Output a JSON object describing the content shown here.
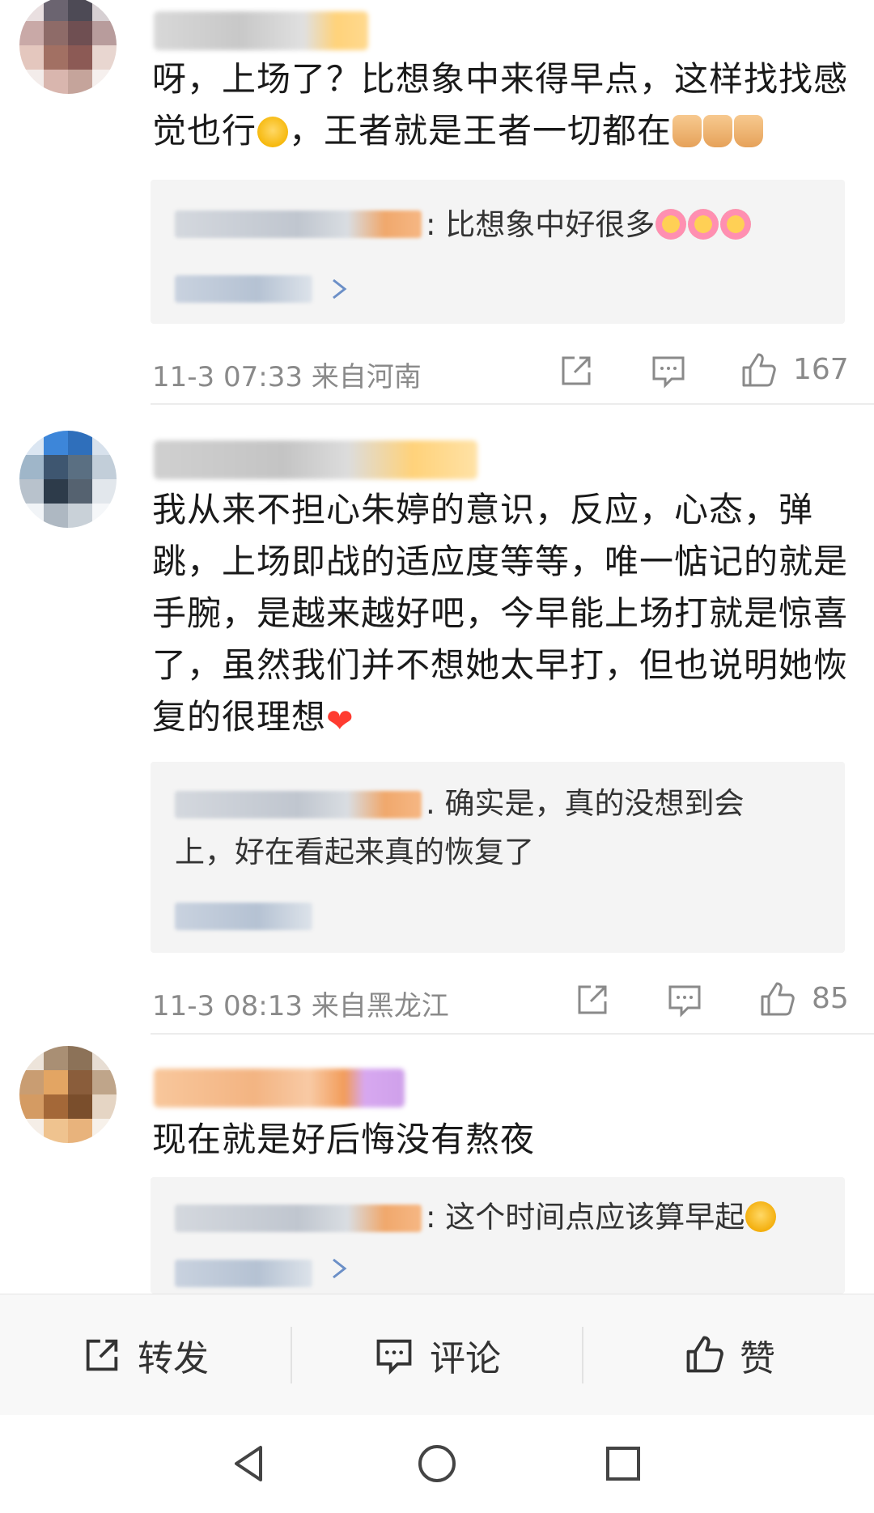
{
  "comments": [
    {
      "text_html_parts": [
        "呀，上场了？比想象中来得早点，这样找找感觉也行",
        "，王者就是王者一切都在"
      ],
      "reply": {
        "text": ": 比想象中好很多"
      },
      "time": "11-3 07:33",
      "location": "来自河南",
      "likes": "167"
    },
    {
      "text": "我从来不担心朱婷的意识，反应，心态，弹跳，上场即战的适应度等等，唯一惦记的就是手腕，是越来越好吧，今早能上场打就是惊喜了，虽然我们并不想她太早打，但也说明她恢复的很理想",
      "reply": {
        "line1": ". 确实是，真的没想到会",
        "line2": "上，好在看起来真的恢复了"
      },
      "time": "11-3 08:13",
      "location": "来自黑龙江",
      "likes": "85"
    },
    {
      "text": "现在就是好后悔没有熬夜",
      "reply": {
        "text": ": 这个时间点应该算早起"
      }
    }
  ],
  "bottom_bar": {
    "repost": "转发",
    "comment": "评论",
    "like": "赞"
  },
  "icons": {
    "share": "share-icon",
    "comment": "comment-icon",
    "like": "thumb-up-icon",
    "nav_back": "triangle-back-icon",
    "nav_home": "circle-home-icon",
    "nav_recent": "square-recent-icon"
  },
  "colors": {
    "meta_gray": "#8a8a8a",
    "reply_bg": "#f4f4f4",
    "heart": "#ff3b30"
  }
}
